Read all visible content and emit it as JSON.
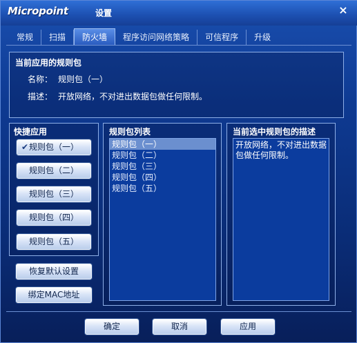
{
  "window": {
    "logo": "Micropoint",
    "title": "设置",
    "close_label": "×"
  },
  "tabs": [
    {
      "label": "常规",
      "active": false
    },
    {
      "label": "扫描",
      "active": false
    },
    {
      "label": "防火墙",
      "active": true
    },
    {
      "label": "程序访问网络策略",
      "active": false
    },
    {
      "label": "可信程序",
      "active": false
    },
    {
      "label": "升级",
      "active": false
    }
  ],
  "current": {
    "heading": "当前应用的规则包",
    "name_key": "名称：",
    "name_value": "规则包（一）",
    "desc_key": "描述：",
    "desc_value": "开放网络，不对进出数据包做任何限制。"
  },
  "quick": {
    "title": "快捷应用",
    "buttons": [
      "规则包（一）",
      "规则包（二）",
      "规则包（三）",
      "规则包（四）",
      "规则包（五）"
    ],
    "checked_index": 0,
    "check_glyph": "✔"
  },
  "actions": {
    "restore_default": "恢复默认设置",
    "bind_mac": "绑定MAC地址"
  },
  "rule_list": {
    "title": "规则包列表",
    "items": [
      "规则包（一）",
      "规则包（二）",
      "规则包（三）",
      "规则包（四）",
      "规则包（五）"
    ],
    "selected_index": 0
  },
  "selected_desc": {
    "title": "当前选中规则包的描述",
    "text": "开放网络，不对进出数据包做任何限制。"
  },
  "footer": {
    "ok": "确定",
    "cancel": "取消",
    "apply": "应用"
  }
}
